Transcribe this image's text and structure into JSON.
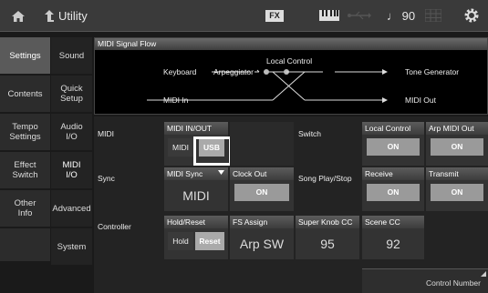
{
  "topbar": {
    "title": "Utility",
    "fx_badge": "FX",
    "tempo": "♩ 90",
    "icons": [
      "home-icon",
      "arrow-up-icon",
      "keyboard-icon",
      "usb-icon",
      "grid-icon",
      "gear-icon"
    ]
  },
  "nav_left": [
    {
      "label": "Settings",
      "active": true
    },
    {
      "label": "Contents",
      "active": false
    },
    {
      "label": "Tempo\nSettings",
      "active": false
    },
    {
      "label": "Effect\nSwitch",
      "active": false
    },
    {
      "label": "Other\nInfo",
      "active": false
    }
  ],
  "nav_sub": [
    {
      "label": "Sound",
      "active": false
    },
    {
      "label": "Quick\nSetup",
      "active": false
    },
    {
      "label": "Audio\nI/O",
      "active": false
    },
    {
      "label": "MIDI\nI/O",
      "active": true
    },
    {
      "label": "Advanced",
      "active": false
    },
    {
      "label": "System",
      "active": false
    }
  ],
  "flow": {
    "title": "MIDI Signal Flow",
    "local_control": "Local Control",
    "keyboard": "Keyboard",
    "arpeggiator": "Arpeggiator",
    "tone_generator": "Tone Generator",
    "midi_in": "MIDI In",
    "midi_out": "MIDI Out"
  },
  "rows": {
    "midi": "MIDI",
    "sync": "Sync",
    "controller": "Controller",
    "switch": "Switch",
    "song_play_stop": "Song Play/Stop"
  },
  "cells": {
    "midi_in_out": {
      "header": "MIDI IN/OUT",
      "opt_midi": "MIDI",
      "opt_usb": "USB",
      "selected": "USB"
    },
    "local_control": {
      "header": "Local Control",
      "value": "ON"
    },
    "arp_midi_out": {
      "header": "Arp MIDI Out",
      "value": "ON"
    },
    "midi_sync": {
      "header": "MIDI Sync",
      "value": "MIDI"
    },
    "clock_out": {
      "header": "Clock Out",
      "value": "ON"
    },
    "receive": {
      "header": "Receive",
      "value": "ON"
    },
    "transmit": {
      "header": "Transmit",
      "value": "ON"
    },
    "hold_reset": {
      "header": "Hold/Reset",
      "opt_hold": "Hold",
      "opt_reset": "Reset",
      "selected": "Reset"
    },
    "fs_assign": {
      "header": "FS Assign",
      "value": "Arp SW"
    },
    "super_knob_cc": {
      "header": "Super Knob CC",
      "value": "95"
    },
    "scene_cc": {
      "header": "Scene CC",
      "value": "92"
    }
  },
  "control_number": "Control Number"
}
